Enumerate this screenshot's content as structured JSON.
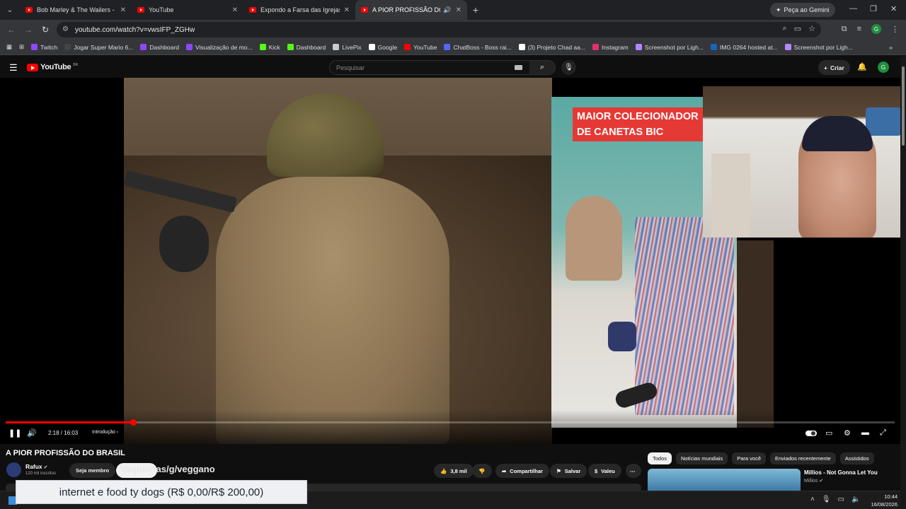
{
  "browser": {
    "tabs": [
      {
        "label": "Bob Marley & The Wailers - Exo"
      },
      {
        "label": "YouTube"
      },
      {
        "label": "Expondo a Farsa das Igrejas Ev"
      },
      {
        "label": "A PIOR PROFISSÃO DO BRA"
      }
    ],
    "gemini_label": "Peça ao Gemini",
    "url": "youtube.com/watch?v=vwsIFP_ZGHw",
    "profile_initial": "G",
    "bookmarks": [
      {
        "label": "Twitch",
        "color": "#9146ff"
      },
      {
        "label": "Jogar Super Mario 6...",
        "color": "#444"
      },
      {
        "label": "Dashboard",
        "color": "#9146ff"
      },
      {
        "label": "Visualização de mo...",
        "color": "#9146ff"
      },
      {
        "label": "Kick",
        "color": "#53fc18"
      },
      {
        "label": "Dashboard",
        "color": "#53fc18"
      },
      {
        "label": "LivePix",
        "color": "#cccccc"
      },
      {
        "label": "Google",
        "color": "#ffffff"
      },
      {
        "label": "YouTube",
        "color": "#ff0000"
      },
      {
        "label": "ChatBoss - Boss rai...",
        "color": "#5865f2"
      },
      {
        "label": "(3) Projeto Chad aa...",
        "color": "#ffffff"
      },
      {
        "label": "Instagram",
        "color": "#e1306c"
      },
      {
        "label": "Screenshot por Ligh...",
        "color": "#b388ff"
      },
      {
        "label": "IMG 0264 hosted at...",
        "color": "#1565c0"
      },
      {
        "label": "Screenshot por Ligh...",
        "color": "#b388ff"
      }
    ]
  },
  "youtube": {
    "logo_text": "YouTube",
    "logo_country": "BR",
    "search_placeholder": "Pesquisar",
    "create_label": "Criar",
    "avatar_initial": "G"
  },
  "player": {
    "overlay_text_line1": "MAIOR COLECIONADOR",
    "overlay_text_line2": "DE CANETAS BIC",
    "current_time": "2:18",
    "duration": "16:03",
    "time_display": "2:18 / 16:03",
    "chapter": "Introdução",
    "progress_fraction": 0.143
  },
  "video": {
    "title": "A PIOR PROFISSÃO DO BRASIL",
    "channel": "Rafux",
    "subscribers": "120 mil inscritos",
    "member_label": "Seja membro",
    "handle_overlay": "Vaquinhas/g/veggano",
    "likes": "3,8 mil",
    "share_label": "Compartilhar",
    "save_label": "Salvar",
    "thanks_label": "Valeu"
  },
  "sidebar": {
    "chips": [
      "Todos",
      "Notícias mundiais",
      "Para você",
      "Enviados recentemente",
      "Assistidos"
    ],
    "rec_title": "Millios - Not Gonna Let You",
    "rec_channel": "Millios"
  },
  "stream_overlay": {
    "donation_goal": "internet e food ty dogs (R$ 0,00/R$ 200,00)"
  },
  "taskbar": {
    "time": "10:44",
    "date": "16/08/2026"
  }
}
